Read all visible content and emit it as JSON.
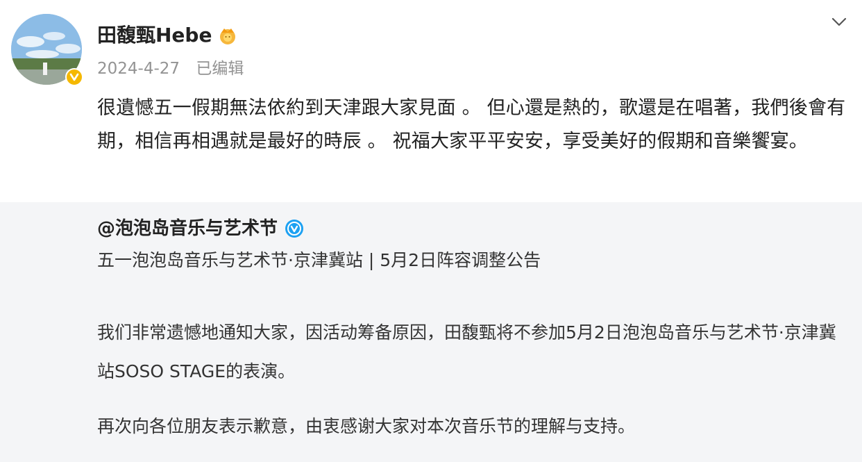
{
  "author": {
    "name": "田馥甄Hebe",
    "date": "2024-4-27",
    "edited_label": "已编辑"
  },
  "post": {
    "text": "很遺憾五一假期無法依約到天津跟大家見面 。 但心還是熱的，歌還是在唱著，我們後會有期，相信再相遇就是最好的時辰 。 祝福大家平平安安，享受美好的假期和音樂饗宴。"
  },
  "repost": {
    "author": "@泡泡岛音乐与艺术节",
    "title": "五一泡泡岛音乐与艺术节·京津冀站 | 5月2日阵容调整公告",
    "paragraph1": "我们非常遗憾地通知大家，因活动筹备原因，田馥甄将不参加5月2日泡泡岛音乐与艺术节·京津冀站SOSO STAGE的表演。",
    "paragraph2": "再次向各位朋友表示歉意，由衷感谢大家对本次音乐节的理解与支持。"
  },
  "icons": {
    "avatar_badge": "verified-badge-icon",
    "name_badge": "crown-icon",
    "menu": "chevron-down-icon",
    "repost_badge": "blue-verified-icon"
  },
  "colors": {
    "badge_gold": "#f5b800",
    "verified_blue": "#1da1f2",
    "meta_gray": "#939393",
    "repost_bg": "#f4f5f7"
  }
}
